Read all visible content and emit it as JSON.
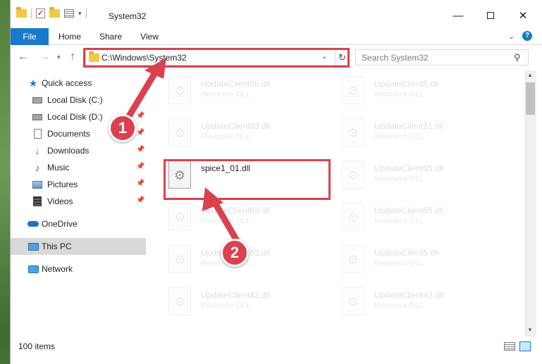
{
  "window": {
    "title": "System32"
  },
  "ribbon": {
    "tabs": [
      "File",
      "Home",
      "Share",
      "View"
    ]
  },
  "address_bar": {
    "path": "C:\\Windows\\System32"
  },
  "search": {
    "placeholder": "Search System32"
  },
  "sidebar": {
    "items": [
      {
        "label": "Quick access",
        "icon": "star-icon"
      },
      {
        "label": "Local Disk (C:)",
        "icon": "drive-icon",
        "pinned": false
      },
      {
        "label": "Local Disk (D:)",
        "icon": "drive-icon",
        "pinned": true
      },
      {
        "label": "Documents",
        "icon": "documents-icon",
        "pinned": true
      },
      {
        "label": "Downloads",
        "icon": "downloads-icon",
        "pinned": true
      },
      {
        "label": "Music",
        "icon": "music-icon",
        "pinned": true
      },
      {
        "label": "Pictures",
        "icon": "pictures-icon",
        "pinned": true
      },
      {
        "label": "Videos",
        "icon": "videos-icon",
        "pinned": true
      },
      {
        "label": "OneDrive",
        "icon": "onedrive-icon"
      },
      {
        "label": "This PC",
        "icon": "this-pc-icon",
        "selected": true
      },
      {
        "label": "Network",
        "icon": "network-icon"
      }
    ]
  },
  "files": [
    {
      "name": "UpdateClient65.dll",
      "type": "Resource DLL"
    },
    {
      "name": "UpdateClient5.dll",
      "type": "Resource DLL"
    },
    {
      "name": "UpdateClient63.dll",
      "type": "Resource DLL"
    },
    {
      "name": "UpdateClient21.dll",
      "type": "Resource DLL"
    },
    {
      "name": "spice1_01.dll",
      "type": ""
    },
    {
      "name": "UpdateClient65.dll",
      "type": "Resource DLL"
    },
    {
      "name": "UpdateClient63.dll",
      "type": "Resource DLL"
    },
    {
      "name": "UpdateClient65.dll",
      "type": "Resource DLL"
    },
    {
      "name": "UpdateClient63.dll",
      "type": "Resource DLL"
    },
    {
      "name": "UpdateClient5.dll",
      "type": "Resource DLL"
    },
    {
      "name": "UpdateClient42.dll",
      "type": "Resource DLL"
    },
    {
      "name": "UpdateClient42.dll",
      "type": "Resource DLL"
    }
  ],
  "status": {
    "item_count": "100 items"
  },
  "annotations": {
    "step1": "1",
    "step2": "2",
    "highlight_color": "#d9414e"
  },
  "colors": {
    "accent": "#1979ca",
    "selection": "#cce8ff"
  }
}
